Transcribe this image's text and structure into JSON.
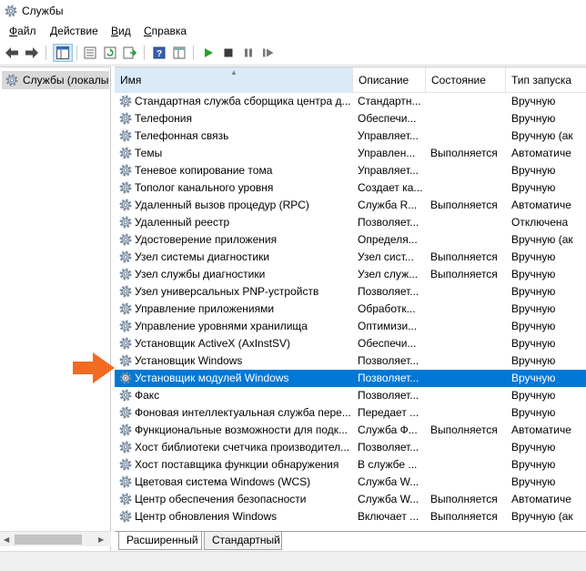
{
  "window": {
    "title": "Службы"
  },
  "menu": [
    {
      "accel": "Ф",
      "rest": "айл"
    },
    {
      "accel": "Д",
      "rest": "ействие"
    },
    {
      "accel": "В",
      "rest": "ид"
    },
    {
      "accel": "С",
      "rest": "правка"
    }
  ],
  "toolbar": {
    "icons": [
      "back-arrow-icon",
      "forward-arrow-icon",
      "console-tree-icon",
      "properties-icon",
      "refresh-icon",
      "export-list-icon",
      "help-icon",
      "view-icon",
      "play-icon",
      "stop-icon",
      "pause-icon",
      "restart-icon"
    ]
  },
  "tree": {
    "root_label": "Службы (локалы"
  },
  "table": {
    "headers": {
      "name": "Имя",
      "description": "Описание",
      "state": "Состояние",
      "startup": "Тип запуска"
    },
    "rows": [
      {
        "name": "Стандартная служба сборщика центра д...",
        "description": "Стандартн...",
        "state": "",
        "startup": "Вручную"
      },
      {
        "name": "Телефония",
        "description": "Обеспечи...",
        "state": "",
        "startup": "Вручную"
      },
      {
        "name": "Телефонная связь",
        "description": "Управляет...",
        "state": "",
        "startup": "Вручную (ак"
      },
      {
        "name": "Темы",
        "description": "Управлен...",
        "state": "Выполняется",
        "startup": "Автоматиче"
      },
      {
        "name": "Теневое копирование тома",
        "description": "Управляет...",
        "state": "",
        "startup": "Вручную"
      },
      {
        "name": "Тополог канального уровня",
        "description": "Создает ка...",
        "state": "",
        "startup": "Вручную"
      },
      {
        "name": "Удаленный вызов процедур (RPC)",
        "description": "Служба R...",
        "state": "Выполняется",
        "startup": "Автоматиче"
      },
      {
        "name": "Удаленный реестр",
        "description": "Позволяет...",
        "state": "",
        "startup": "Отключена"
      },
      {
        "name": "Удостоверение приложения",
        "description": "Определя...",
        "state": "",
        "startup": "Вручную (ак"
      },
      {
        "name": "Узел системы диагностики",
        "description": "Узел сист...",
        "state": "Выполняется",
        "startup": "Вручную"
      },
      {
        "name": "Узел службы диагностики",
        "description": "Узел служ...",
        "state": "Выполняется",
        "startup": "Вручную"
      },
      {
        "name": "Узел универсальных PNP-устройств",
        "description": "Позволяет...",
        "state": "",
        "startup": "Вручную"
      },
      {
        "name": "Управление приложениями",
        "description": "Обработк...",
        "state": "",
        "startup": "Вручную"
      },
      {
        "name": "Управление уровнями хранилища",
        "description": "Оптимизи...",
        "state": "",
        "startup": "Вручную"
      },
      {
        "name": "Установщик ActiveX (AxInstSV)",
        "description": "Обеспечи...",
        "state": "",
        "startup": "Вручную"
      },
      {
        "name": "Установщик Windows",
        "description": "Позволяет...",
        "state": "",
        "startup": "Вручную"
      },
      {
        "name": "Установщик модулей Windows",
        "description": "Позволяет...",
        "state": "",
        "startup": "Вручную",
        "selected": true
      },
      {
        "name": "Факс",
        "description": "Позволяет...",
        "state": "",
        "startup": "Вручную"
      },
      {
        "name": "Фоновая интеллектуальная служба пере...",
        "description": "Передает ...",
        "state": "",
        "startup": "Вручную"
      },
      {
        "name": "Функциональные возможности для подк...",
        "description": "Служба Ф...",
        "state": "Выполняется",
        "startup": "Автоматиче"
      },
      {
        "name": "Хост библиотеки счетчика производител...",
        "description": "Позволяет...",
        "state": "",
        "startup": "Вручную"
      },
      {
        "name": "Хост поставщика функции обнаружения",
        "description": "В службе ...",
        "state": "",
        "startup": "Вручную"
      },
      {
        "name": "Цветовая система Windows (WCS)",
        "description": "Служба W...",
        "state": "",
        "startup": "Вручную"
      },
      {
        "name": "Центр обеспечения безопасности",
        "description": "Служба W...",
        "state": "Выполняется",
        "startup": "Автоматиче"
      },
      {
        "name": "Центр обновления Windows",
        "description": "Включает ...",
        "state": "Выполняется",
        "startup": "Вручную (ак"
      }
    ]
  },
  "tabs": [
    "Расширенный",
    "Стандартный"
  ],
  "colors": {
    "selection": "#0078d7",
    "annotation_arrow": "#f26b21"
  }
}
